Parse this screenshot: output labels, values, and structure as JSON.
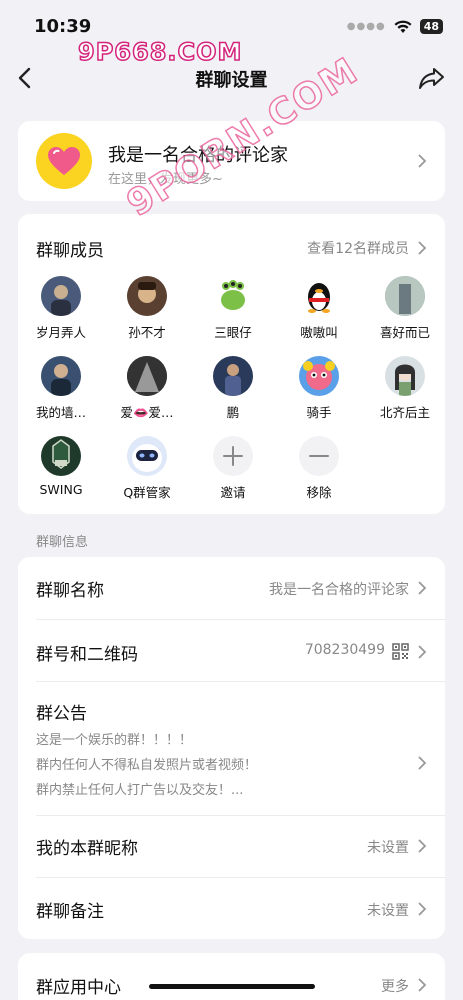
{
  "status": {
    "time": "10:39",
    "battery": "48"
  },
  "watermarks": {
    "top": "9P668.COM",
    "diagonal": "9PORN.COM"
  },
  "nav": {
    "title": "群聊设置"
  },
  "profile": {
    "name": "我是一名合格的评论家",
    "subtitle": "在这里，发现更多~"
  },
  "members": {
    "title": "群聊成员",
    "link": "查看12名群成员",
    "list": [
      {
        "name": "岁月弄人",
        "color": "#4a5a7a"
      },
      {
        "name": "孙不才",
        "color": "#5a4030"
      },
      {
        "name": "三眼仔",
        "color": "#ffffff"
      },
      {
        "name": "嗷嗷叫",
        "color": "#ffffff"
      },
      {
        "name": "喜好而已",
        "color": "#8aa0a0"
      },
      {
        "name": "我的墙…",
        "color": "#3a5070"
      },
      {
        "name": "爱👄爱…",
        "color": "#555555"
      },
      {
        "name": "鹏",
        "color": "#2a3a5a"
      },
      {
        "name": "骑手",
        "color": "#5aa0e8"
      },
      {
        "name": "北齐后主",
        "color": "#d8e0e4"
      },
      {
        "name": "SWING",
        "color": "#1f3a2a"
      },
      {
        "name": "Q群管家",
        "color": "#dfe8f8"
      },
      {
        "name": "邀请",
        "color": "#f2f2f4"
      },
      {
        "name": "移除",
        "color": "#f2f2f4"
      }
    ]
  },
  "section_info_label": "群聊信息",
  "info": {
    "name_label": "群聊名称",
    "name_value": "我是一名合格的评论家",
    "number_label": "群号和二维码",
    "number_value": "708230499",
    "notice_label": "群公告",
    "notice_lines": [
      "这是一个娱乐的群！！！！",
      "群内任何人不得私自发照片或者视频！",
      "群内禁止任何人打广告以及交友！..."
    ],
    "nickname_label": "我的本群昵称",
    "nickname_value": "未设置",
    "remark_label": "群聊备注",
    "remark_value": "未设置"
  },
  "apps": {
    "label": "群应用中心",
    "value": "更多"
  }
}
